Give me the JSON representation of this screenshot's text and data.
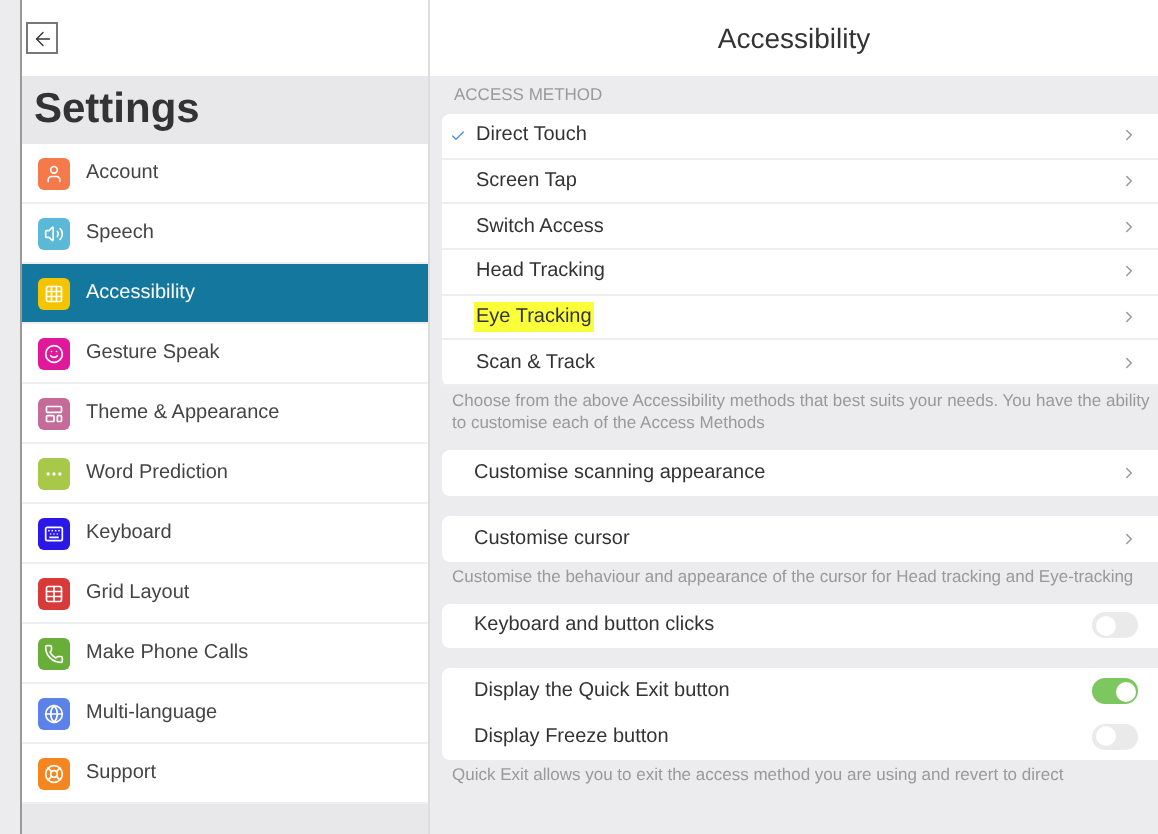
{
  "sidebar": {
    "title": "Settings",
    "items": [
      {
        "label": "Account",
        "color": "#f47a4c",
        "selected": false
      },
      {
        "label": "Speech",
        "color": "#5bb8d6",
        "selected": false
      },
      {
        "label": "Accessibility",
        "color": "#f5c400",
        "selected": true
      },
      {
        "label": "Gesture Speak",
        "color": "#e0189a",
        "selected": false
      },
      {
        "label": "Theme & Appearance",
        "color": "#c56b9a",
        "selected": false
      },
      {
        "label": "Word Prediction",
        "color": "#a8c84a",
        "selected": false
      },
      {
        "label": "Keyboard",
        "color": "#2a18e8",
        "selected": false
      },
      {
        "label": "Grid Layout",
        "color": "#d83a3a",
        "selected": false
      },
      {
        "label": "Make Phone Calls",
        "color": "#6aae3a",
        "selected": false
      },
      {
        "label": "Multi-language",
        "color": "#5b82e8",
        "selected": false
      },
      {
        "label": "Support",
        "color": "#f5861f",
        "selected": false
      }
    ]
  },
  "page": {
    "title": "Accessibility",
    "section_label": "ACCESS METHOD",
    "methods": [
      {
        "label": "Direct Touch",
        "selected": true,
        "highlighted": false
      },
      {
        "label": "Screen Tap",
        "selected": false,
        "highlighted": false
      },
      {
        "label": "Switch Access",
        "selected": false,
        "highlighted": false
      },
      {
        "label": "Head Tracking",
        "selected": false,
        "highlighted": false
      },
      {
        "label": "Eye Tracking",
        "selected": false,
        "highlighted": true
      },
      {
        "label": "Scan & Track",
        "selected": false,
        "highlighted": false
      }
    ],
    "methods_note": "Choose from the above Accessibility methods that best suits your needs. You have the ability to customise each of the Access Methods",
    "groups": [
      {
        "rows": [
          {
            "kind": "link",
            "label": "Customise scanning appearance"
          }
        ]
      },
      {
        "rows": [
          {
            "kind": "link",
            "label": "Customise cursor"
          }
        ],
        "note": "Customise the behaviour and appearance of the cursor for Head tracking and Eye-tracking"
      },
      {
        "rows": [
          {
            "kind": "toggle",
            "label": "Keyboard and button clicks",
            "on": false
          }
        ]
      },
      {
        "rows": [
          {
            "kind": "toggle",
            "label": "Display the Quick Exit button",
            "on": true
          },
          {
            "kind": "toggle",
            "label": "Display Freeze button",
            "on": false
          }
        ],
        "note": "Quick Exit allows you to exit the access method you are using and revert to direct"
      }
    ]
  }
}
